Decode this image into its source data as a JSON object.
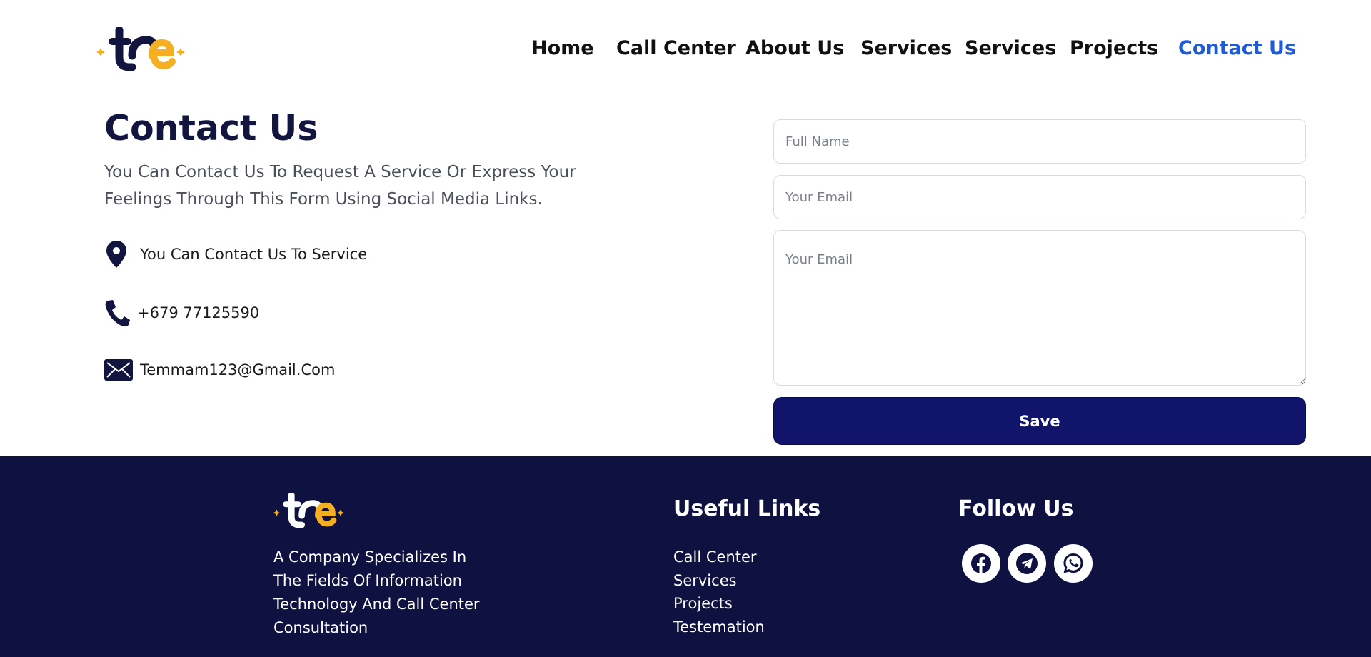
{
  "brand": {
    "logo_text": "tre",
    "primary_color": "#12163f",
    "accent_color": "#f4b022",
    "active_link_color": "#1f5bd6",
    "button_color": "#10146b",
    "footer_bg": "#0f1240"
  },
  "nav": {
    "items": [
      {
        "label": "Home"
      },
      {
        "label": "Call Center"
      },
      {
        "label": "About Us"
      },
      {
        "label": "Services"
      },
      {
        "label": "Services"
      },
      {
        "label": "Projects"
      },
      {
        "label": "Contact Us",
        "active": true
      }
    ]
  },
  "contact": {
    "title": "Contact Us",
    "description": "You Can Contact Us To Request A Service Or Express Your Feelings Through This Form Using Social Media Links.",
    "address": {
      "icon": "location-pin-icon",
      "text": "You Can Contact Us To Service"
    },
    "phone": {
      "icon": "phone-icon",
      "text": "+679 77125590"
    },
    "email": {
      "icon": "envelope-icon",
      "text": "Temmam123@Gmail.Com"
    }
  },
  "form": {
    "full_name_placeholder": "Full Name",
    "email_placeholder": "Your Email",
    "message_placeholder": "Your Email",
    "save_label": "Save"
  },
  "footer": {
    "logo_text": "tre",
    "description": "A Company Specializes In The Fields Of Information Technology And Call Center Consultation",
    "useful_links_heading": "Useful Links",
    "useful_links": [
      "Call Center",
      "Services",
      "Projects",
      "Testemation"
    ],
    "follow_heading": "Follow Us",
    "social": [
      {
        "icon": "facebook-icon"
      },
      {
        "icon": "telegram-icon"
      },
      {
        "icon": "whatsapp-icon"
      }
    ]
  }
}
